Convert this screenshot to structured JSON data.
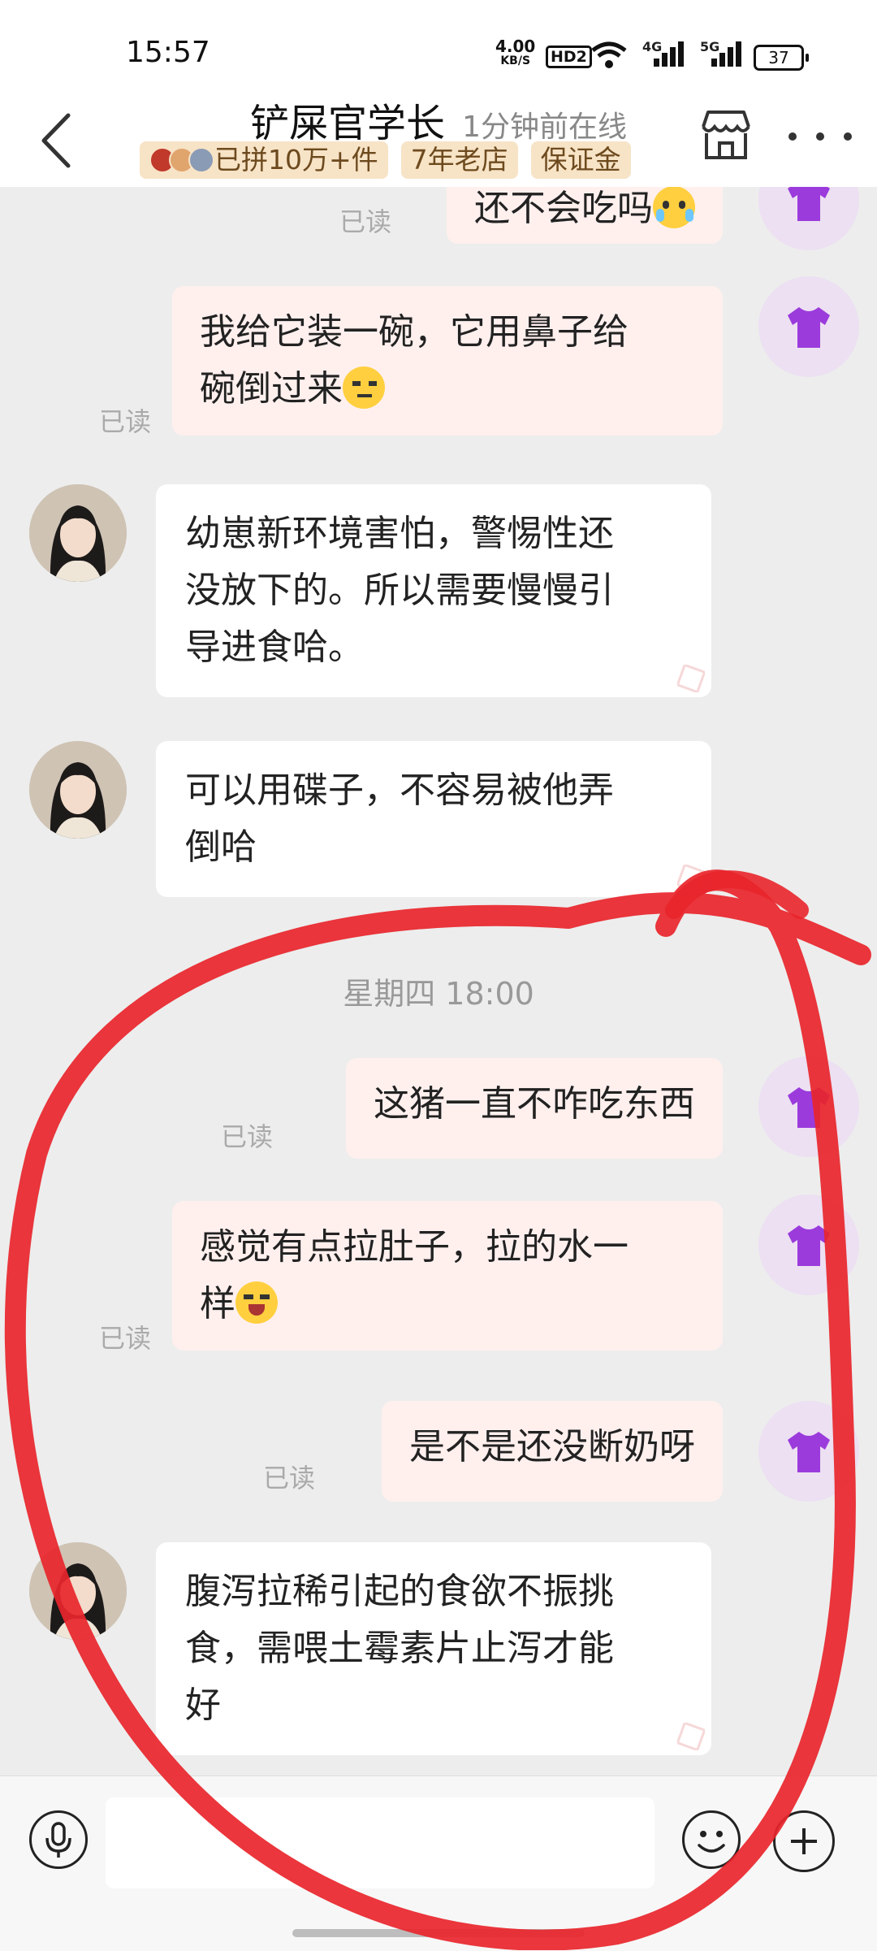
{
  "status_bar": {
    "time": "15:57",
    "net_speed_value": "4.00",
    "net_speed_unit": "KB/S",
    "hd_label": "HD2",
    "signal_4g": "4G",
    "signal_5g": "5G",
    "battery": "37"
  },
  "header": {
    "shop_name": "铲屎官学长",
    "online_status": "1分钟前在线",
    "badges": [
      "已拼10万+件",
      "7年老店",
      "保证金"
    ],
    "back_icon": "chevron-left-icon",
    "store_icon": "store-icon",
    "more_icon": "more-dots-icon"
  },
  "chat": {
    "messages": [
      {
        "side": "right",
        "text": "还不会吃吗",
        "read": "已读"
      },
      {
        "side": "right",
        "line1": "我给它装一碗，它用鼻子给",
        "line2": "碗倒过来",
        "read": "已读"
      },
      {
        "side": "left",
        "lines": [
          "幼崽新环境害怕，警惕性还",
          "没放下的。所以需要慢慢引",
          "导进食哈。"
        ]
      },
      {
        "side": "left",
        "lines": [
          "可以用碟子，不容易被他弄",
          "倒哈"
        ]
      },
      {
        "side": "right",
        "text": "这猪一直不咋吃东西",
        "read": "已读"
      },
      {
        "side": "right",
        "line1": "感觉有点拉肚子，拉的水一",
        "line2": "样",
        "read": "已读"
      },
      {
        "side": "right",
        "text": "是不是还没断奶呀",
        "read": "已读"
      },
      {
        "side": "left",
        "lines": [
          "腹泻拉稀引起的食欲不振挑",
          "食，需喂土霉素片止泻才能",
          "好"
        ]
      }
    ],
    "date_divider": "星期四 18:00"
  },
  "colors": {
    "annotation_circle": "#e8252b",
    "badge_bg": "#f7e3c6",
    "right_bubble": "#fff0ee",
    "shirt": "#9b3bdc"
  }
}
